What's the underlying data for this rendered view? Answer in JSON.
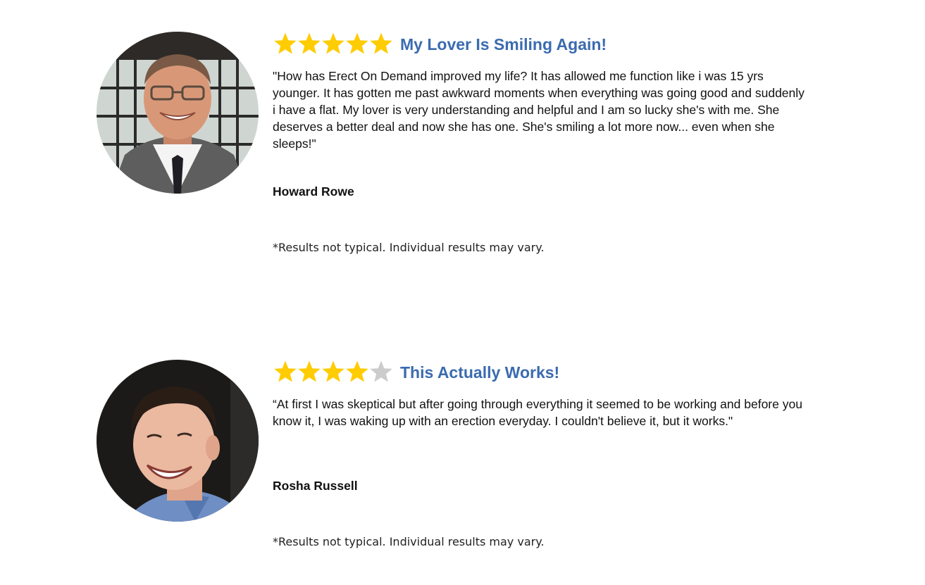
{
  "colors": {
    "star_filled": "#FFCC00",
    "star_empty": "#CCCCCC",
    "headline": "#3B6BB0",
    "text": "#111111"
  },
  "testimonials": [
    {
      "rating": 5,
      "max_rating": 5,
      "headline": "My Lover Is Smiling Again!",
      "quote": "\"How has Erect On Demand improved my life? It has allowed me function like i was 15 yrs younger. It has gotten me past awkward moments when everything was going good and suddenly i have a flat. My lover is very understanding and helpful and I am so lucky she's with me. She deserves a better deal and now she has one. She's smiling a lot more now... even when she sleeps!\"",
      "author": "Howard Rowe",
      "disclaimer": "*Results not typical. Individual results may vary.",
      "avatar_icon": "avatar-photo-older-man"
    },
    {
      "rating": 4,
      "max_rating": 5,
      "headline": "This Actually Works!",
      "quote": "“At first I was skeptical but after going through everything it seemed to be working and before you know it, I was waking up with an erection everyday. I couldn't believe it, but it works.\"",
      "author": "Rosha Russell",
      "disclaimer": "*Results not typical. Individual results may vary.",
      "avatar_icon": "avatar-photo-young-man"
    }
  ]
}
